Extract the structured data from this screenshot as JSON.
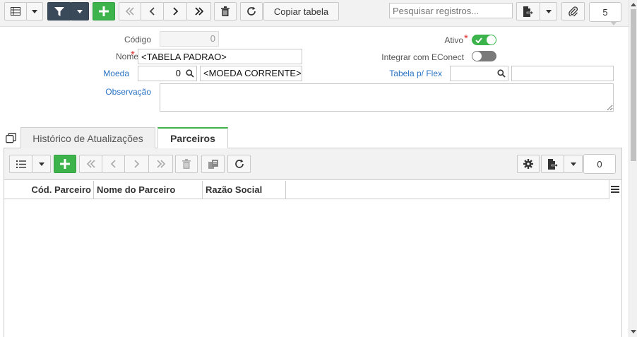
{
  "toolbar": {
    "copy_label": "Copiar tabela",
    "search_placeholder": "Pesquisar registros...",
    "count": "5"
  },
  "form": {
    "codigo_label": "Código",
    "codigo_value": "0",
    "nome_label": "Nome",
    "nome_value": "<TABELA PADRAO>",
    "moeda_label": "Moeda",
    "moeda_code": "0",
    "moeda_name": "<MOEDA CORRENTE>",
    "observacao_label": "Observação",
    "observacao_value": "",
    "ativo_label": "Ativo",
    "ativo_on": true,
    "econect_label": "Integrar com EConect",
    "econect_on": false,
    "flex_label": "Tabela p/ Flex",
    "flex_value": "",
    "flex_desc": "",
    "required_mark": "*"
  },
  "tabs": [
    {
      "label": "Histórico de Atualizações",
      "active": false
    },
    {
      "label": "Parceiros",
      "active": true
    }
  ],
  "grid": {
    "count": "0",
    "columns": [
      "Cód. Parceiro",
      "Nome do Parceiro",
      "Razão Social"
    ],
    "rows": []
  },
  "colors": {
    "accent_green": "#3cb44b",
    "toolbar_dark": "#3b4a5a",
    "link_blue": "#2a73c4",
    "required_red": "#e03030"
  }
}
